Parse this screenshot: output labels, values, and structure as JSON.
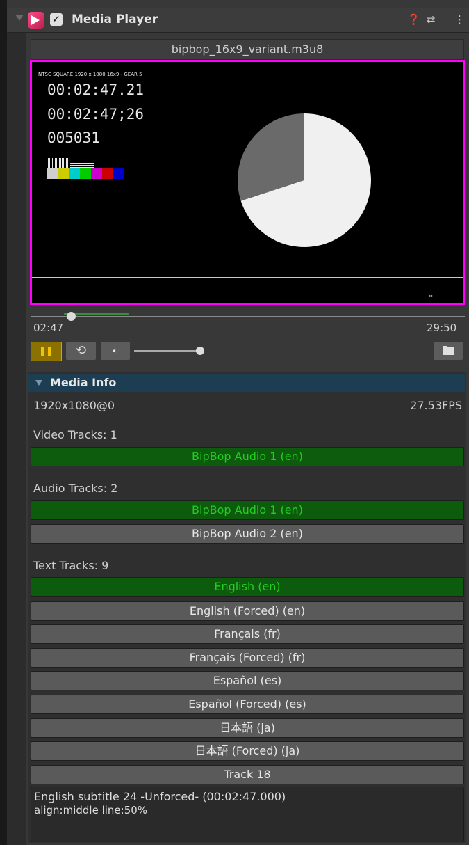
{
  "window": {
    "title": "Media Player",
    "icons": [
      "help-icon",
      "settings-sliders-icon",
      "more-vertical-icon"
    ],
    "enabled": true
  },
  "player": {
    "filename": "bipbop_16x9_variant.m3u8",
    "current_time": "02:47",
    "duration": "29:50",
    "progress": 0.093,
    "buffered_start": 0.077,
    "buffered_end": 0.227,
    "volume": 1.0,
    "state": "playing"
  },
  "video": {
    "top_text": "NTSC SQUARE  1920 x 1080  16x9  -  GEAR 5",
    "timecode_1": "00:02:47.21",
    "timecode_2": "00:02:47;26",
    "frame_count": "005031",
    "color_bars": [
      "#cfcfcf",
      "#cccc00",
      "#00cccc",
      "#00cc00",
      "#cc00cc",
      "#cc0000",
      "#0000cc"
    ],
    "pie_filled_fraction": 0.7
  },
  "media_info": {
    "title": "Media Info",
    "resolution": "1920x1080@0",
    "fps": "27.53FPS",
    "video_tracks_label": "Video Tracks: 1",
    "video_tracks": [
      {
        "label": "BipBop Audio 1 (en)",
        "selected": true
      }
    ],
    "audio_tracks_label": "Audio Tracks: 2",
    "audio_tracks": [
      {
        "label": "BipBop Audio 1 (en)",
        "selected": true
      },
      {
        "label": "BipBop Audio 2 (en)",
        "selected": false
      }
    ],
    "text_tracks_label": "Text Tracks: 9",
    "text_tracks": [
      {
        "label": "English (en)",
        "selected": true
      },
      {
        "label": "English (Forced) (en)",
        "selected": false
      },
      {
        "label": "Français (fr)",
        "selected": false
      },
      {
        "label": "Français (Forced) (fr)",
        "selected": false
      },
      {
        "label": "Español (es)",
        "selected": false
      },
      {
        "label": "Español (Forced) (es)",
        "selected": false
      },
      {
        "label": "日本語 (ja)",
        "selected": false
      },
      {
        "label": "日本語 (Forced) (ja)",
        "selected": false
      },
      {
        "label": "Track 18",
        "selected": false
      }
    ],
    "subtitle_line_1": "English subtitle 24 -Unforced- (00:02:47.000)",
    "subtitle_line_2": "align:middle line:50%"
  },
  "colors": {
    "accent_border": "#ff00ff",
    "selected_track_bg": "#0d5c0d",
    "selected_track_text": "#20cf20",
    "play_button": "#f5c400",
    "info_header_bg": "#1d3d52"
  }
}
